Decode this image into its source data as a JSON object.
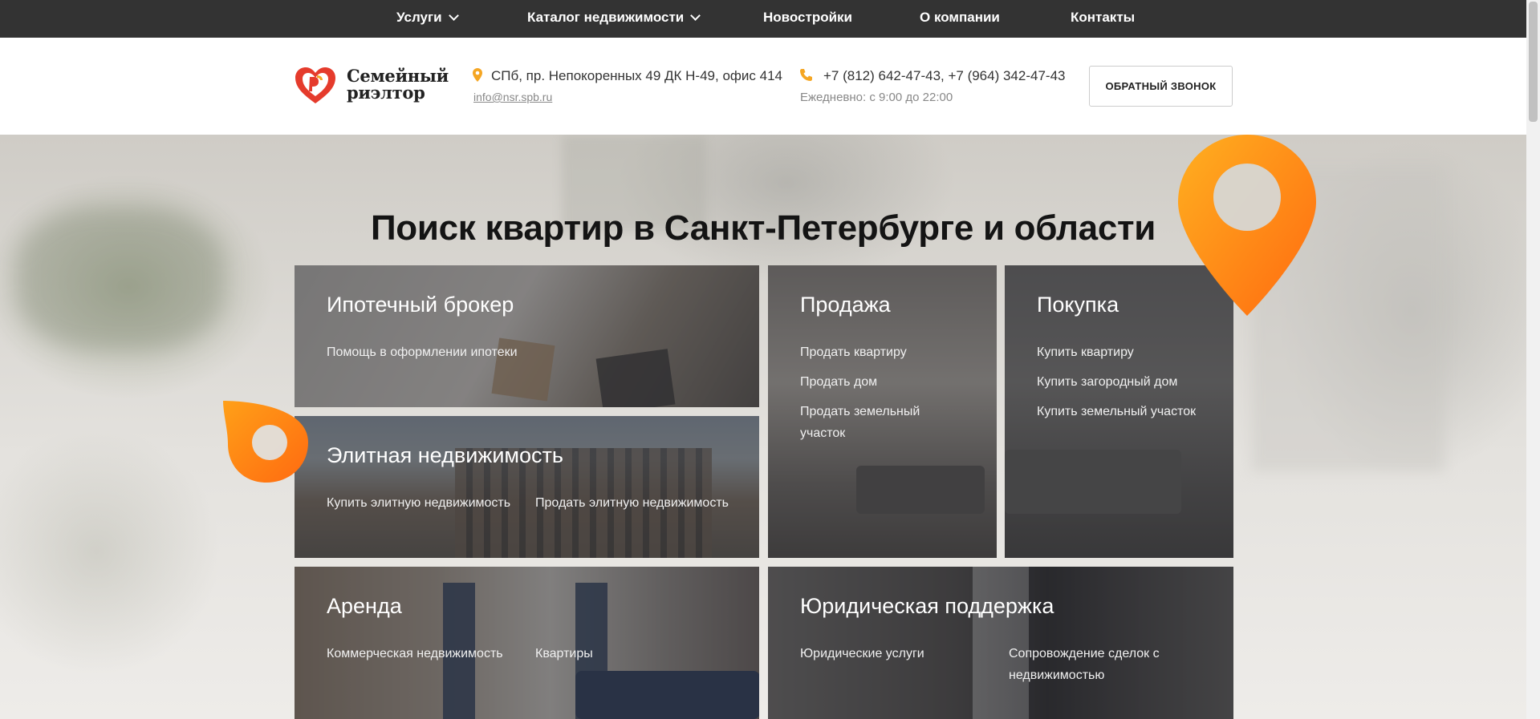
{
  "nav": {
    "items": [
      {
        "label": "Услуги",
        "has_dropdown": true
      },
      {
        "label": "Каталог недвижимости",
        "has_dropdown": true
      },
      {
        "label": "Новостройки",
        "has_dropdown": false
      },
      {
        "label": "О компании",
        "has_dropdown": false
      },
      {
        "label": "Контакты",
        "has_dropdown": false
      }
    ]
  },
  "header": {
    "logo_line1": "Семейный",
    "logo_line2": "риэлтор",
    "address": "СПб, пр. Непокоренных 49 ДК Н-49, офис 414",
    "email": "info@nsr.spb.ru",
    "phones": "+7 (812) 642-47-43, +7 (964) 342-47-43",
    "hours": "Ежедневно: с 9:00 до 22:00",
    "callback_label": "ОБРАТНЫЙ ЗВОНОК",
    "address_icon": "location-pin-icon",
    "phone_icon": "phone-icon"
  },
  "hero": {
    "title": "Поиск квартир в Санкт-Петербурге и области",
    "accent_color": "#ff7a10"
  },
  "cards": {
    "mortgage": {
      "title": "Ипотечный брокер",
      "links": [
        "Помощь в оформлении ипотеки"
      ]
    },
    "elite": {
      "title": "Элитная недвижимость",
      "links": [
        "Купить элитную недвижимость",
        "Продать элитную недвижимость"
      ]
    },
    "sale": {
      "title": "Продажа",
      "links": [
        "Продать квартиру",
        "Продать дом",
        "Продать земельный участок"
      ]
    },
    "purchase": {
      "title": "Покупка",
      "links": [
        "Купить квартиру",
        "Купить загородный дом",
        "Купить земельный участок"
      ]
    },
    "rent": {
      "title": "Аренда",
      "links": [
        "Коммерческая недвижимость",
        "Квартиры"
      ]
    },
    "legal": {
      "title": "Юридическая поддержка",
      "links": [
        "Юридические услуги",
        "Сопровождение сделок с недвижимостью"
      ]
    }
  }
}
